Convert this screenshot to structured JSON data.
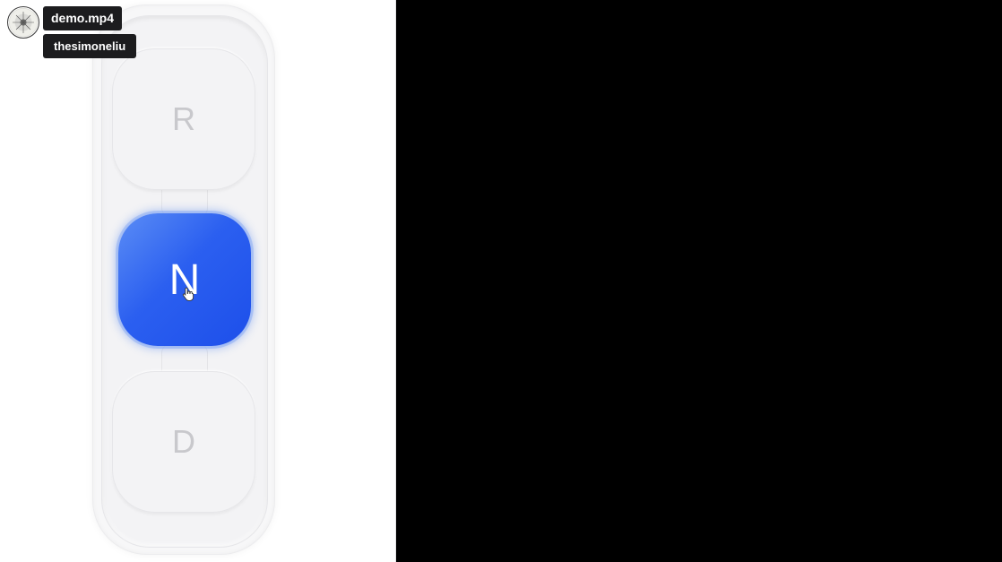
{
  "overlay": {
    "file_name": "demo.mp4",
    "username": "thesimoneliu"
  },
  "gear_selector": {
    "options": [
      {
        "label": "R",
        "state": "inactive"
      },
      {
        "label": "N",
        "state": "selected"
      },
      {
        "label": "D",
        "state": "inactive"
      }
    ],
    "selected": "N",
    "colors": {
      "selected_fill": "#2b5ff0",
      "selected_highlight": "#5b8df5",
      "inactive_text": "#c8c8cc",
      "track": "#f3f3f5"
    }
  },
  "icons": {
    "avatar": "avatar-icon",
    "cursor": "hand-cursor-icon"
  }
}
